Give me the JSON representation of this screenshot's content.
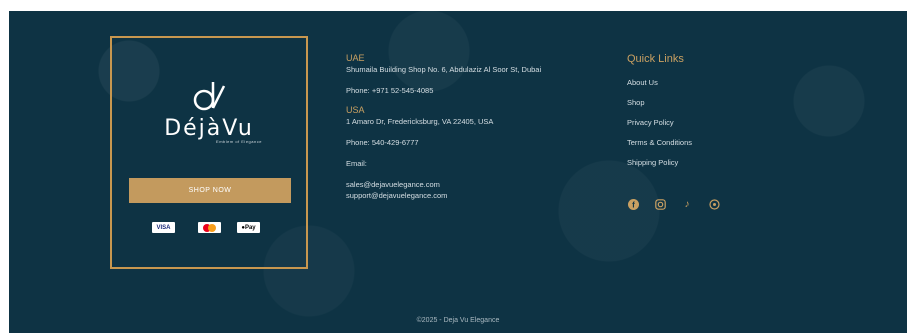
{
  "brand": {
    "name": "DéjàVu",
    "tagline": "Emblem of Elegance",
    "button": "SHOP NOW",
    "payments": [
      "VISA",
      "Mastercard",
      "Apple Pay"
    ]
  },
  "locations": [
    {
      "region": "UAE",
      "address": "Shumaila Building Shop No. 6, Abdulaziz Al Soor St, Dubai",
      "phone": "Phone: +971 52-545-4085"
    },
    {
      "region": "USA",
      "address": "1 Amaro Dr, Fredericksburg, VA 22405, USA",
      "phone": "Phone: 540-429-6777"
    }
  ],
  "email": {
    "label": "Email:",
    "addresses": [
      "sales@dejavuelegance.com",
      "support@dejavuelegance.com"
    ]
  },
  "quick_links": {
    "heading": "Quick Links",
    "items": [
      "About Us",
      "Shop",
      "Privacy Policy",
      "Terms & Conditions",
      "Shipping Policy"
    ]
  },
  "social": [
    "facebook-icon",
    "instagram-icon",
    "tiktok-icon",
    "whatsapp-icon"
  ],
  "copyright": "©2025 - Deja Vu Elegance",
  "colors": {
    "background": "#0e3344",
    "accent": "#c9a062"
  }
}
